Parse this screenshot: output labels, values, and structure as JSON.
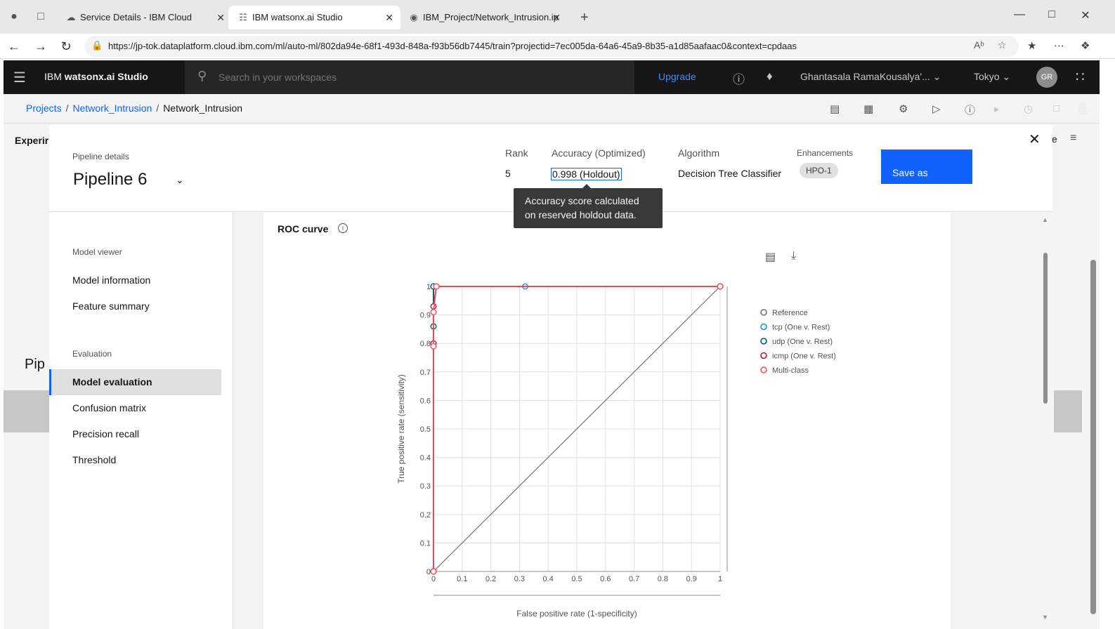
{
  "browser": {
    "tabs": [
      {
        "title": "Service Details - IBM Cloud",
        "favicon": "cloud-icon"
      },
      {
        "title": "IBM watsonx.ai Studio",
        "favicon": "network-icon"
      },
      {
        "title": "IBM_Project/Network_Intrusion.ip",
        "favicon": "github-icon"
      }
    ],
    "url": "https://jp-tok.dataplatform.cloud.ibm.com/ml/auto-ml/802da94e-68f1-493d-848a-f93b56db7445/train?projectid=7ec005da-64a6-45a9-8b35-a1d85aafaac0&context=cpdaas"
  },
  "header": {
    "brand_prefix": "IBM ",
    "brand_name": "watsonx.ai Studio",
    "search_placeholder": "Search in your workspaces",
    "upgrade": "Upgrade",
    "account": "Ghantasala RamaKousalya'...",
    "region": "Tokyo",
    "avatar_initials": "GR"
  },
  "breadcrumb": {
    "items": [
      "Projects",
      "Network_Intrusion",
      "Network_Intrusion"
    ]
  },
  "background_page": {
    "experiment_label": "Experir",
    "pipeline_label": "Pip",
    "right_label": "e"
  },
  "modal": {
    "pipeline_details_label": "Pipeline details",
    "pipeline_name": "Pipeline 6",
    "rank_label": "Rank",
    "rank_value": "5",
    "accuracy_label": "Accuracy (Optimized)",
    "accuracy_value": "0.998 (Holdout)",
    "algorithm_label": "Algorithm",
    "algorithm_value": "Decision Tree Classifier",
    "enhancements_label": "Enhancements",
    "enhancement_tag": "HPO-1",
    "save_as": "Save as",
    "tooltip": "Accuracy score calculated on reserved holdout data."
  },
  "sidenav": {
    "model_viewer_label": "Model viewer",
    "model_viewer_items": [
      "Model information",
      "Feature summary"
    ],
    "evaluation_label": "Evaluation",
    "evaluation_items": [
      "Model evaluation",
      "Confusion matrix",
      "Precision recall",
      "Threshold"
    ],
    "active_item": "Model evaluation"
  },
  "roc": {
    "title": "ROC curve"
  },
  "colors": {
    "accent": "#0f62fe",
    "reference": "#6f6f6f",
    "tcp": "#1192e8",
    "udp": "#005d5d",
    "icmp": "#9f1853",
    "multiclass": "#fa4d56"
  },
  "chart_data": {
    "type": "line",
    "title": "ROC curve",
    "xlabel": "False positive rate (1-specificity)",
    "ylabel": "True positive rate (sensitivity)",
    "xlim": [
      0,
      1
    ],
    "ylim": [
      0,
      1
    ],
    "grid": true,
    "legend_position": "right",
    "x_ticks": [
      "0",
      "0.1",
      "0.2",
      "0.3",
      "0.4",
      "0.5",
      "0.6",
      "0.7",
      "0.8",
      "0.9",
      "1"
    ],
    "y_ticks": [
      "0",
      "0.1",
      "0.2",
      "0.3",
      "0.4",
      "0.5",
      "0.6",
      "0.7",
      "0.8",
      "0.9",
      "1"
    ],
    "series": [
      {
        "name": "Reference",
        "color": "#6f6f6f",
        "marker": false,
        "x": [
          0,
          1
        ],
        "y": [
          0,
          1
        ]
      },
      {
        "name": "tcp (One v. Rest)",
        "color": "#1192e8",
        "marker": true,
        "x": [
          0,
          0,
          0.32,
          1
        ],
        "y": [
          0,
          1,
          1,
          1
        ]
      },
      {
        "name": "udp (One v. Rest)",
        "color": "#005d5d",
        "marker": true,
        "x": [
          0,
          0,
          0,
          1
        ],
        "y": [
          0,
          0.86,
          1,
          1
        ]
      },
      {
        "name": "icmp (One v. Rest)",
        "color": "#9f1853",
        "marker": true,
        "x": [
          0,
          0,
          0,
          0.01,
          1
        ],
        "y": [
          0,
          0.8,
          0.93,
          1,
          1
        ]
      },
      {
        "name": "Multi-class",
        "color": "#fa4d56",
        "marker": true,
        "x": [
          0,
          0,
          0,
          0.01,
          1
        ],
        "y": [
          0,
          0.79,
          0.91,
          1,
          1
        ]
      }
    ]
  }
}
